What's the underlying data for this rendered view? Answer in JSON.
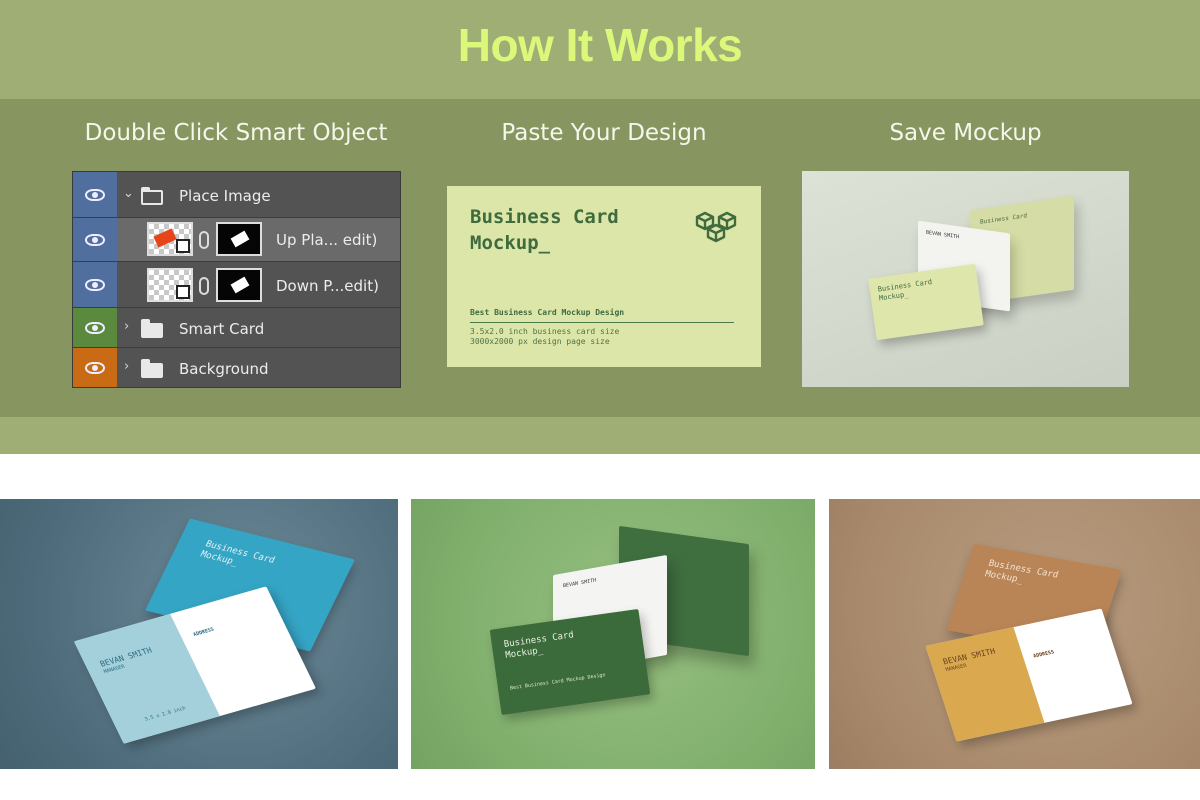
{
  "header": {
    "title": "How It Works"
  },
  "steps": [
    {
      "title": "Double Click Smart Object"
    },
    {
      "title": "Paste Your Design"
    },
    {
      "title": "Save Mockup"
    }
  ],
  "layers_panel": {
    "layers": [
      {
        "name": "Place Image",
        "type": "group",
        "expanded": true,
        "eye_color": "#516f9e"
      },
      {
        "name": "Up Pla... edit)",
        "type": "smart-object",
        "selected": true,
        "eye_color": "#516f9e"
      },
      {
        "name": "Down P...edit)",
        "type": "smart-object",
        "selected": false,
        "eye_color": "#516f9e"
      },
      {
        "name": "Smart Card",
        "type": "group",
        "expanded": false,
        "eye_color": "#5b8a3e"
      },
      {
        "name": "Background",
        "type": "group",
        "expanded": false,
        "eye_color": "#c96a14"
      }
    ]
  },
  "flat_card": {
    "title": "Business Card\nMockup_",
    "subtitle": "Best Business Card Mockup Design",
    "line1": "3.5x2.0 inch business card size",
    "line2": "3000x2000 px design page size",
    "logo_icon": "stacked-cubes-icon",
    "bg_color": "#dde6a9",
    "ink_color": "#3f6b3f"
  },
  "mockups": {
    "save": {
      "card_title": "Business Card\nMockup_",
      "back_name": "BEVAN SMITH",
      "top_title": "Business Card"
    },
    "blue": {
      "card_title": "Business Card\nMockup_",
      "person_name": "BEVAN SMITH",
      "person_role": "MANAGER",
      "address_label": "ADDRESS",
      "size_note": "3.5 x 2.0 inch"
    },
    "green": {
      "card_title": "Business Card\nMockup_",
      "person_name": "BEVAN SMITH",
      "subtitle": "Best Business Card Mockup Design"
    },
    "tan": {
      "card_title": "Business Card\nMockup_",
      "person_name": "BEVAN SMITH",
      "person_role": "MANAGER",
      "address_label": "ADDRESS"
    }
  },
  "colors": {
    "top_band": "#9eae75",
    "inner_band": "#879560",
    "title_color": "#dcf87a",
    "blue_bg": "#4d6b7a",
    "green_bg": "#7fae6b",
    "tan_bg": "#a8896b"
  }
}
